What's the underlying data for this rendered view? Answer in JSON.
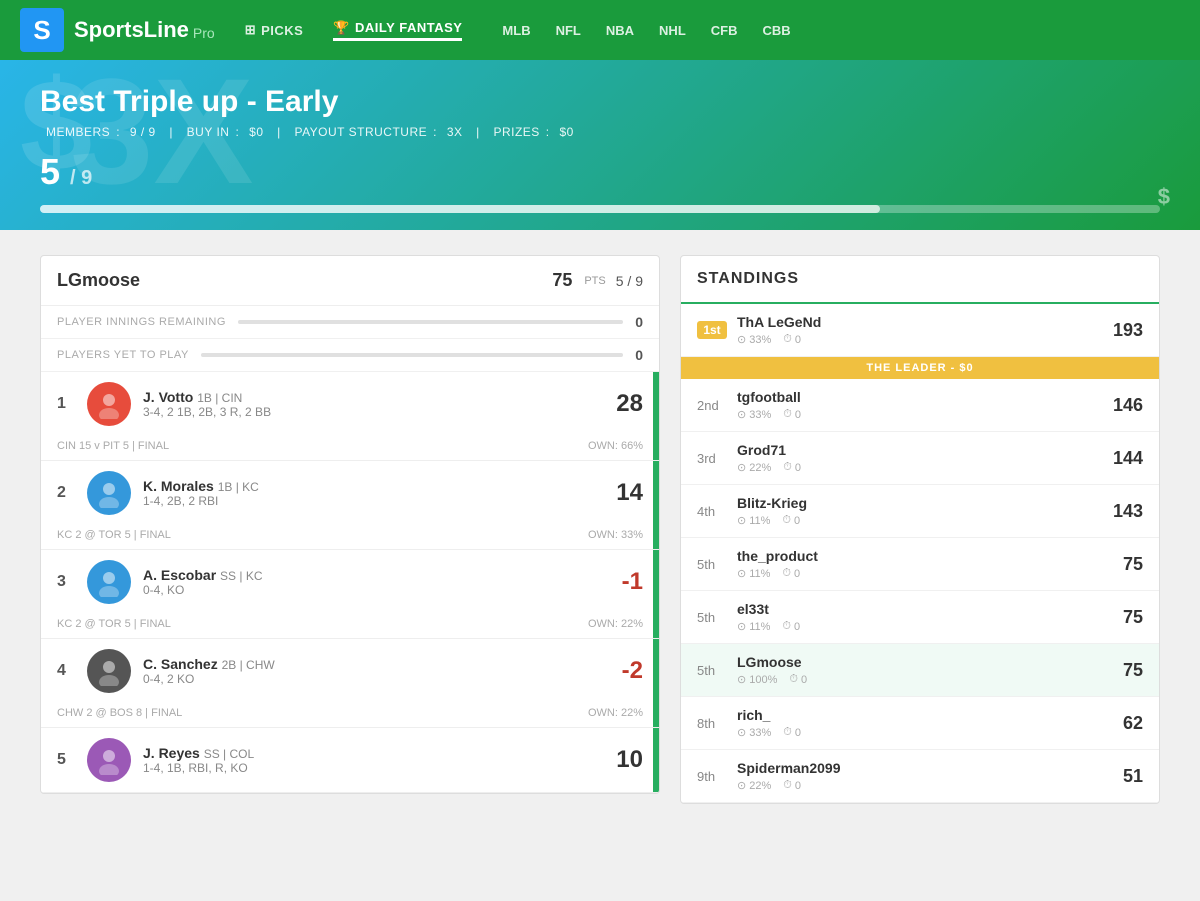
{
  "header": {
    "logo_letter": "S",
    "logo_text": "SportsLine",
    "logo_pro": "Pro",
    "nav": [
      {
        "label": "PICKS",
        "icon": "grid-icon",
        "active": false
      },
      {
        "label": "DAILY FANTASY",
        "icon": "trophy-icon",
        "active": true
      },
      {
        "label": "MLB",
        "active": false
      },
      {
        "label": "NFL",
        "active": false
      },
      {
        "label": "NBA",
        "active": false
      },
      {
        "label": "NHL",
        "active": false
      },
      {
        "label": "CFB",
        "active": false
      },
      {
        "label": "CBB",
        "active": false
      }
    ]
  },
  "hero": {
    "bg_dollar": "$",
    "bg_3x": "3X",
    "title": "Best Triple up - Early",
    "members_label": "MEMBERS",
    "members_value": "9 / 9",
    "buyin_label": "BUY IN",
    "buyin_value": "$0",
    "payout_label": "PAYOUT STRUCTURE",
    "payout_value": "3X",
    "prizes_label": "PRIZES",
    "prizes_value": "$0",
    "score": "5",
    "score_total": "/ 9",
    "progress_pct": 75,
    "dollar_sign": "$"
  },
  "team": {
    "name": "LGmoose",
    "pts": "75",
    "pts_label": "PTS",
    "rank": "5 / 9",
    "innings_label": "PLAYER INNINGS REMAINING",
    "innings_value": "0",
    "yet_to_play_label": "PLAYERS YET TO PLAY",
    "yet_to_play_value": "0"
  },
  "players": [
    {
      "num": "1",
      "name": "J. Votto",
      "pos": "1B | CIN",
      "stats": "3-4, 2 1B, 2B, 3 R, 2 BB",
      "score": "28",
      "negative": false,
      "game": "CIN 15 v PIT 5 | FINAL",
      "own": "OWN: 66%",
      "avatar_color": "#e74c3c"
    },
    {
      "num": "2",
      "name": "K. Morales",
      "pos": "1B | KC",
      "stats": "1-4, 2B, 2 RBI",
      "score": "14",
      "negative": false,
      "game": "KC 2 @ TOR 5 | FINAL",
      "own": "OWN: 33%",
      "avatar_color": "#3498db"
    },
    {
      "num": "3",
      "name": "A. Escobar",
      "pos": "SS | KC",
      "stats": "0-4, KO",
      "score": "-1",
      "negative": true,
      "game": "KC 2 @ TOR 5 | FINAL",
      "own": "OWN: 22%",
      "avatar_color": "#3498db"
    },
    {
      "num": "4",
      "name": "C. Sanchez",
      "pos": "2B | CHW",
      "stats": "0-4, 2 KO",
      "score": "-2",
      "negative": true,
      "game": "CHW 2 @ BOS 8 | FINAL",
      "own": "OWN: 22%",
      "avatar_color": "#555"
    },
    {
      "num": "5",
      "name": "J. Reyes",
      "pos": "SS | COL",
      "stats": "1-4, 1B, RBI, R, KO",
      "score": "10",
      "negative": false,
      "game": "",
      "own": "",
      "avatar_color": "#9b59b6"
    }
  ],
  "standings": {
    "title": "STANDINGS",
    "entries": [
      {
        "rank": "1st",
        "rank_type": "badge",
        "name": "ThA LeGeNd",
        "pct": "33%",
        "clock": "0",
        "score": "193",
        "is_leader": true,
        "leader_label": "THE LEADER - $0",
        "highlight": false
      },
      {
        "rank": "2nd",
        "rank_type": "text",
        "name": "tgfootball",
        "pct": "33%",
        "clock": "0",
        "score": "146",
        "is_leader": false,
        "highlight": false
      },
      {
        "rank": "3rd",
        "rank_type": "text",
        "name": "Grod71",
        "pct": "22%",
        "clock": "0",
        "score": "144",
        "is_leader": false,
        "highlight": false
      },
      {
        "rank": "4th",
        "rank_type": "text",
        "name": "Blitz-Krieg",
        "pct": "11%",
        "clock": "0",
        "score": "143",
        "is_leader": false,
        "highlight": false
      },
      {
        "rank": "5th",
        "rank_type": "text",
        "name": "the_product",
        "pct": "11%",
        "clock": "0",
        "score": "75",
        "is_leader": false,
        "highlight": false
      },
      {
        "rank": "5th",
        "rank_type": "text",
        "name": "el33t",
        "pct": "11%",
        "clock": "0",
        "score": "75",
        "is_leader": false,
        "highlight": false
      },
      {
        "rank": "5th",
        "rank_type": "text",
        "name": "LGmoose",
        "pct": "100%",
        "clock": "0",
        "score": "75",
        "is_leader": false,
        "highlight": true
      },
      {
        "rank": "8th",
        "rank_type": "text",
        "name": "rich_",
        "pct": "33%",
        "clock": "0",
        "score": "62",
        "is_leader": false,
        "highlight": false
      },
      {
        "rank": "9th",
        "rank_type": "text",
        "name": "Spiderman2099",
        "pct": "22%",
        "clock": "0",
        "score": "51",
        "is_leader": false,
        "highlight": false
      }
    ]
  }
}
